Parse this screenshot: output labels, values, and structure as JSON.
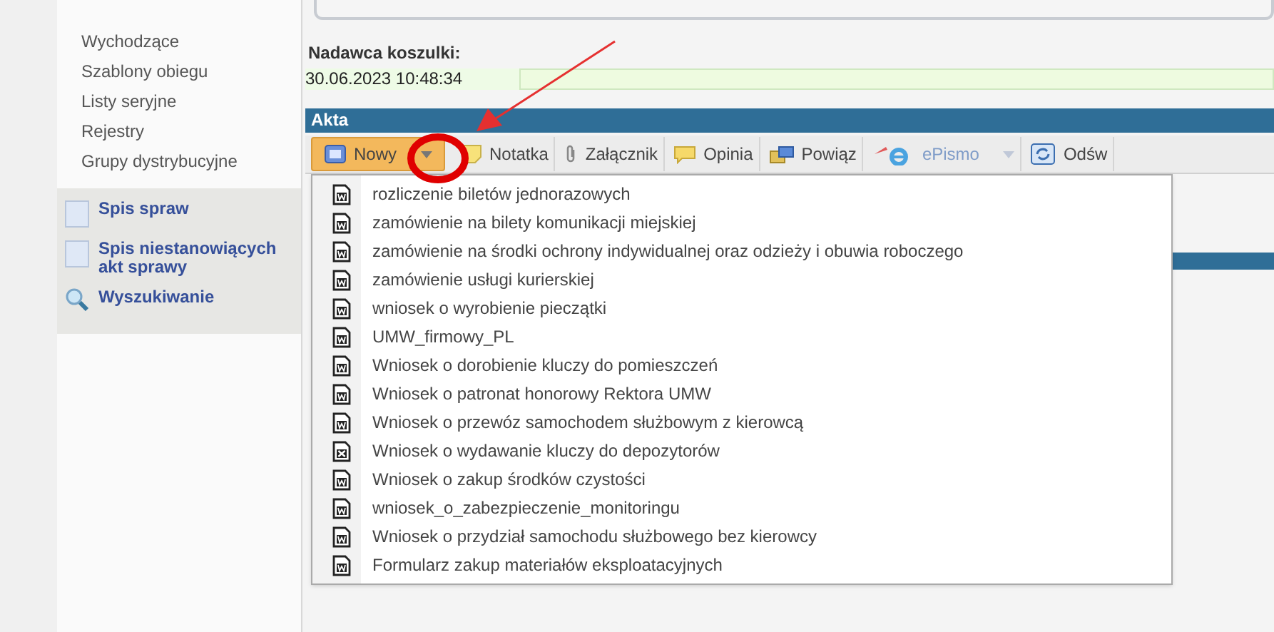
{
  "sidebar": {
    "links": [
      "Wychodzące",
      "Szablony obiegu",
      "Listy seryjne",
      "Rejestry",
      "Grupy dystrybucyjne"
    ],
    "sections": [
      {
        "kind": "document",
        "label": "Spis spraw"
      },
      {
        "kind": "document",
        "label": "Spis niestanowiących akt sprawy"
      },
      {
        "kind": "search",
        "label": "Wyszukiwanie"
      }
    ]
  },
  "sender": {
    "label": "Nadawca koszulki:",
    "value": "30.06.2023 10:48:34"
  },
  "panel": {
    "title": "Akta"
  },
  "toolbar": [
    {
      "kind": "new",
      "label": "Nowy",
      "pressed": true,
      "disabled": false,
      "has_dropdown": true
    },
    {
      "kind": "note",
      "label": "Notatka",
      "pressed": false,
      "disabled": false,
      "has_dropdown": false
    },
    {
      "kind": "attachment",
      "label": "Załącznik",
      "pressed": false,
      "disabled": false,
      "has_dropdown": false
    },
    {
      "kind": "opinion",
      "label": "Opinia",
      "pressed": false,
      "disabled": false,
      "has_dropdown": false
    },
    {
      "kind": "link",
      "label": "Powiąz",
      "pressed": false,
      "disabled": false,
      "has_dropdown": false
    },
    {
      "kind": "epismo",
      "label": "ePismo",
      "pressed": false,
      "disabled": true,
      "has_dropdown": true
    },
    {
      "kind": "refresh",
      "label": "Odśw",
      "pressed": false,
      "disabled": false,
      "has_dropdown": false
    }
  ],
  "menu": [
    {
      "kind": "word",
      "label": "rozliczenie biletów jednorazowych"
    },
    {
      "kind": "word",
      "label": "zamówienie na bilety komunikacji miejskiej"
    },
    {
      "kind": "word",
      "label": "zamówienie na środki ochrony indywidualnej oraz odzieży i obuwia roboczego"
    },
    {
      "kind": "word",
      "label": "zamówienie usługi kurierskiej"
    },
    {
      "kind": "word",
      "label": "wniosek o wyrobienie pieczątki"
    },
    {
      "kind": "word",
      "label": "UMW_firmowy_PL"
    },
    {
      "kind": "word",
      "label": "Wniosek o dorobienie kluczy do pomieszczeń"
    },
    {
      "kind": "word",
      "label": "Wniosek o patronat honorowy Rektora UMW"
    },
    {
      "kind": "word",
      "label": "Wniosek o przewóz samochodem służbowym z kierowcą"
    },
    {
      "kind": "excel",
      "label": "Wniosek o wydawanie kluczy do depozytorów"
    },
    {
      "kind": "word",
      "label": "Wniosek o zakup środków czystości"
    },
    {
      "kind": "word",
      "label": "wniosek_o_zabezpieczenie_monitoringu"
    },
    {
      "kind": "word",
      "label": "Wniosek o przydział samochodu służbowego bez kierowcy"
    },
    {
      "kind": "word",
      "label": "Formularz zakup materiałów eksploatacyjnych"
    }
  ]
}
